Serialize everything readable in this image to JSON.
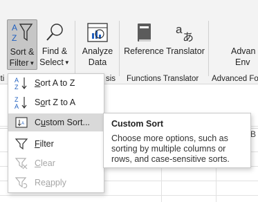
{
  "ribbon": {
    "left_partial_label": "iti",
    "buttons": {
      "sort_filter": {
        "line1": "Sort &",
        "line2": "Filter"
      },
      "find_select": {
        "line1": "Find &",
        "line2": "Select"
      },
      "analyze_data": {
        "line1": "Analyze",
        "line2": "Data"
      },
      "reference": {
        "label": "Reference"
      },
      "translator": {
        "label": "Translator"
      },
      "advanced": {
        "line1": "Advan",
        "line2": "Env"
      }
    },
    "groups": {
      "analysis_partial": "sis",
      "functions_translator": "Functions Translator",
      "advanced_partial": "Advanced Fo"
    }
  },
  "menu": {
    "items": [
      {
        "pre": "",
        "acc": "S",
        "post": "ort A to Z",
        "icon": "sort-a-to-z-icon",
        "enabled": true
      },
      {
        "pre": "S",
        "acc": "o",
        "post": "rt Z to A",
        "icon": "sort-z-to-a-icon",
        "enabled": true
      },
      {
        "pre": "C",
        "acc": "u",
        "post": "stom Sort...",
        "icon": "custom-sort-icon",
        "enabled": true
      },
      {
        "pre": "",
        "acc": "F",
        "post": "ilter",
        "icon": "filter-icon",
        "enabled": true
      },
      {
        "pre": "",
        "acc": "C",
        "post": "lear",
        "icon": "clear-filter-icon",
        "enabled": false
      },
      {
        "pre": "Re",
        "acc": "a",
        "post": "pply",
        "icon": "reapply-filter-icon",
        "enabled": false
      }
    ]
  },
  "tooltip": {
    "title": "Custom Sort",
    "body": "Choose more options, such as sorting by multiple columns or rows, and case-sensitive sorts."
  },
  "sheet": {
    "col_partial": "B"
  },
  "colors": {
    "hover": "#d9d9d9",
    "active_button": "#c6c6c6",
    "sort_blue": "#1f5fbf",
    "disabled": "#a6a6a6"
  }
}
